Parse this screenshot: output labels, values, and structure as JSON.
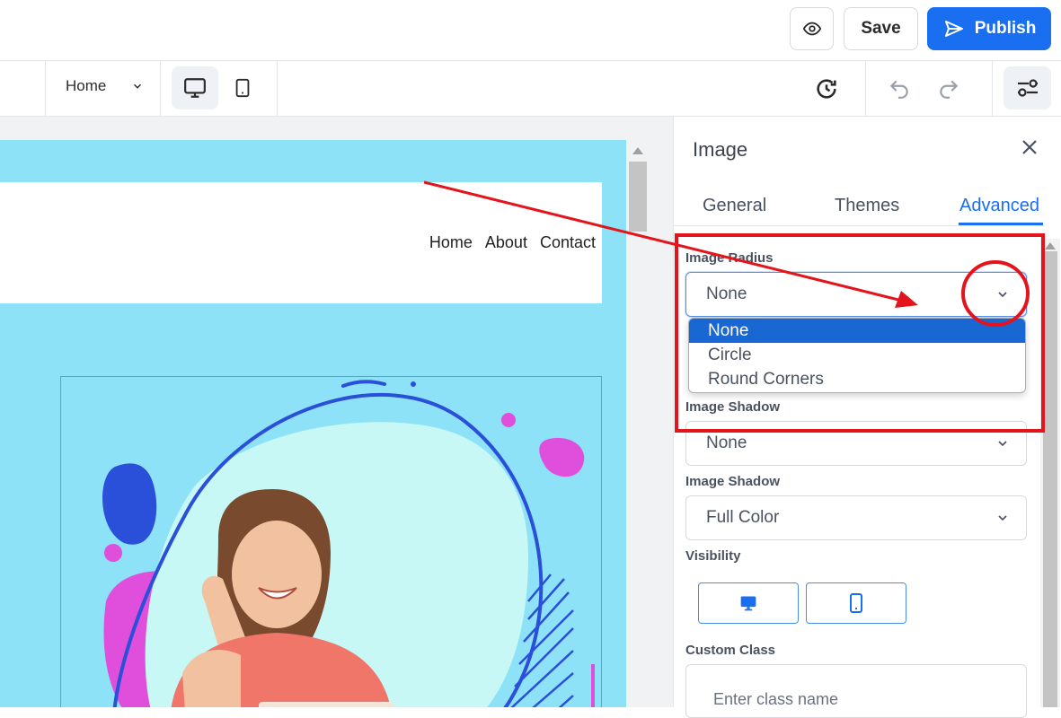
{
  "topbar": {
    "save_label": "Save",
    "publish_label": "Publish"
  },
  "toolbar": {
    "page_select": "Home"
  },
  "site": {
    "nav": [
      "Home",
      "About",
      "Contact"
    ]
  },
  "panel": {
    "title": "Image",
    "tabs": [
      {
        "label": "General",
        "active": false
      },
      {
        "label": "Themes",
        "active": false
      },
      {
        "label": "Advanced",
        "active": true
      }
    ],
    "image_radius": {
      "label": "Image Radius",
      "value": "None",
      "options": [
        "None",
        "Circle",
        "Round Corners"
      ],
      "selected": "None"
    },
    "image_shadow_1": {
      "label": "Image Shadow",
      "value": "None"
    },
    "image_shadow_2": {
      "label": "Image Shadow",
      "value": "Full Color"
    },
    "visibility": {
      "label": "Visibility"
    },
    "custom_class": {
      "label": "Custom Class",
      "placeholder": "Enter class name"
    }
  },
  "colors": {
    "accent": "#1a6ff0",
    "annotation": "#e3141c",
    "canvas_bg": "#8ee2f8",
    "selected_option": "#1967d2"
  }
}
